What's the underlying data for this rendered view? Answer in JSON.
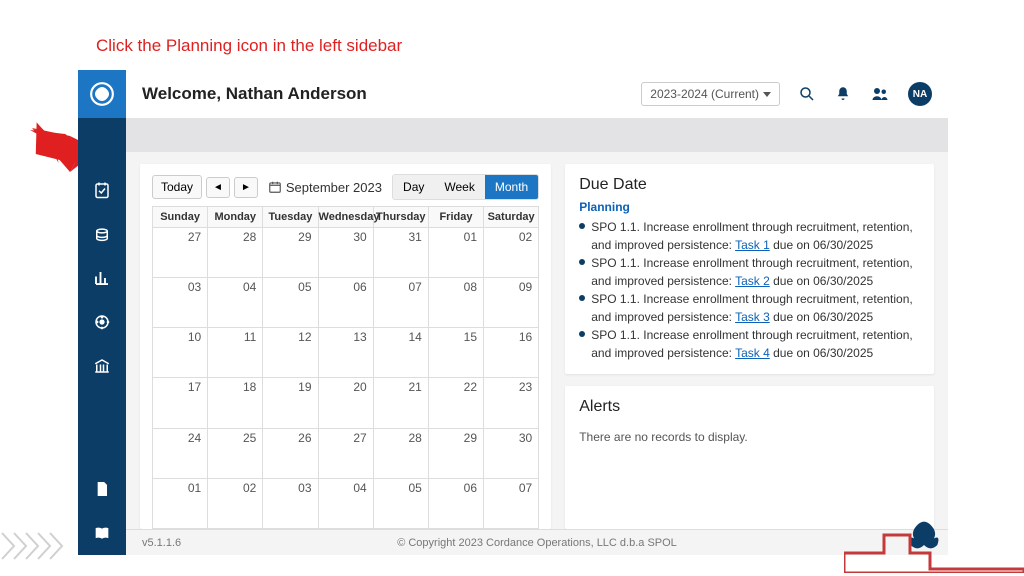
{
  "instruction": "Click the Planning icon in the left sidebar",
  "sidebar": {
    "items": [
      {
        "name": "logo"
      },
      {
        "name": "planning"
      },
      {
        "name": "assessment"
      },
      {
        "name": "reports"
      },
      {
        "name": "accreditation"
      },
      {
        "name": "institution"
      }
    ]
  },
  "topbar": {
    "welcome": "Welcome, Nathan Anderson",
    "year": "2023-2024 (Current)",
    "avatar_initials": "NA"
  },
  "calendar": {
    "today_label": "Today",
    "month_label": "September 2023",
    "views": {
      "day": "Day",
      "week": "Week",
      "month": "Month",
      "active": "month"
    },
    "day_headers": [
      "Sunday",
      "Monday",
      "Tuesday",
      "Wednesday",
      "Thursday",
      "Friday",
      "Saturday"
    ],
    "weeks": [
      [
        "27",
        "28",
        "29",
        "30",
        "31",
        "01",
        "02"
      ],
      [
        "03",
        "04",
        "05",
        "06",
        "07",
        "08",
        "09"
      ],
      [
        "10",
        "11",
        "12",
        "13",
        "14",
        "15",
        "16"
      ],
      [
        "17",
        "18",
        "19",
        "20",
        "21",
        "22",
        "23"
      ],
      [
        "24",
        "25",
        "26",
        "27",
        "28",
        "29",
        "30"
      ],
      [
        "01",
        "02",
        "03",
        "04",
        "05",
        "06",
        "07"
      ]
    ]
  },
  "due_date": {
    "title": "Due Date",
    "section_label": "Planning",
    "items": [
      {
        "text_pre": "SPO 1.1. Increase enrollment through recruitment, retention, and improved persistence:  ",
        "link": "Task 1",
        "text_post": "  due on 06/30/2025"
      },
      {
        "text_pre": "SPO 1.1. Increase enrollment through recruitment, retention, and improved persistence:  ",
        "link": "Task 2",
        "text_post": "  due on 06/30/2025"
      },
      {
        "text_pre": "SPO 1.1. Increase enrollment through recruitment, retention, and improved persistence:  ",
        "link": "Task 3",
        "text_post": "  due on 06/30/2025"
      },
      {
        "text_pre": "SPO 1.1. Increase enrollment through recruitment, retention, and improved persistence:  ",
        "link": "Task 4",
        "text_post": "  due on 06/30/2025"
      }
    ]
  },
  "alerts": {
    "title": "Alerts",
    "no_records": "There are no records to display."
  },
  "footer": {
    "version": "v5.1.1.6",
    "copyright": "© Copyright 2023 Cordance Operations, LLC d.b.a SPOL"
  }
}
